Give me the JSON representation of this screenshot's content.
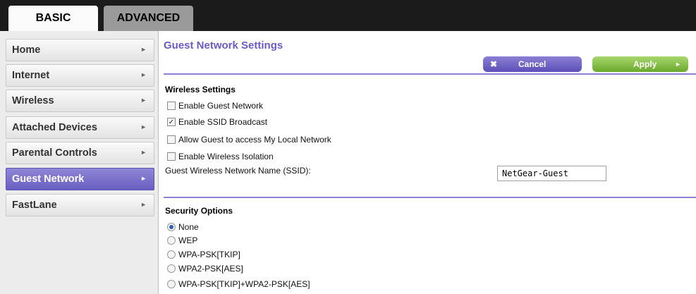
{
  "tabs": [
    {
      "label": "BASIC",
      "active": true
    },
    {
      "label": "ADVANCED",
      "active": false
    }
  ],
  "sidebar": {
    "items": [
      {
        "label": "Home",
        "active": false
      },
      {
        "label": "Internet",
        "active": false
      },
      {
        "label": "Wireless",
        "active": false
      },
      {
        "label": "Attached Devices",
        "active": false
      },
      {
        "label": "Parental Controls",
        "active": false
      },
      {
        "label": "Guest Network",
        "active": true
      },
      {
        "label": "FastLane",
        "active": false
      }
    ],
    "chevron_icon": "chevron-right-icon"
  },
  "main": {
    "title": "Guest Network Settings",
    "cancel_label": "Cancel",
    "apply_label": "Apply",
    "wireless": {
      "title": "Wireless Settings",
      "options": [
        {
          "label": "Enable Guest Network",
          "checked": false
        },
        {
          "label": "Enable SSID Broadcast",
          "checked": true
        },
        {
          "label": "Allow Guest to access My Local Network",
          "checked": false
        },
        {
          "label": "Enable Wireless Isolation",
          "checked": false
        }
      ],
      "ssid_label": "Guest Wireless Network Name (SSID):",
      "ssid_value": "NetGear-Guest"
    },
    "security": {
      "title": "Security Options",
      "options": [
        {
          "label": "None",
          "selected": true
        },
        {
          "label": "WEP",
          "selected": false
        },
        {
          "label": "WPA-PSK[TKIP]",
          "selected": false
        },
        {
          "label": "WPA2-PSK[AES]",
          "selected": false
        },
        {
          "label": "WPA-PSK[TKIP]+WPA2-PSK[AES]",
          "selected": false
        }
      ]
    }
  },
  "colors": {
    "accent_purple": "#6c5ac6",
    "apply_green": "#6aa82d",
    "topbar": "#1b1b1b"
  }
}
